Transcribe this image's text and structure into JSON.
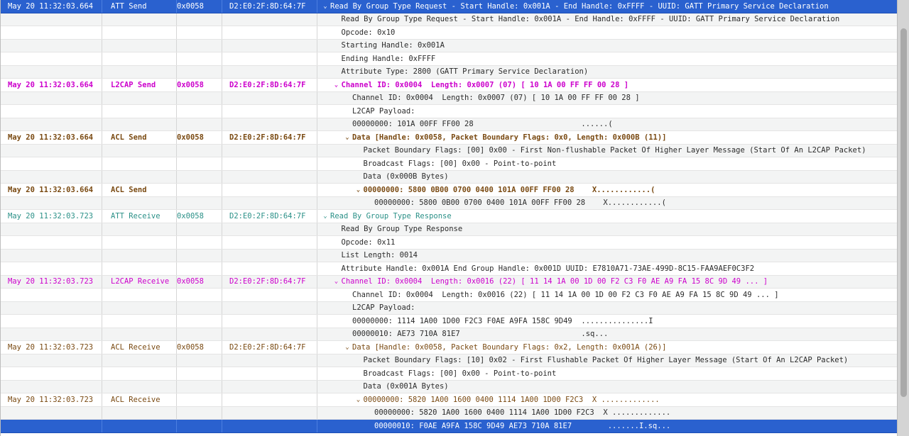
{
  "rows": [
    {
      "selected": true,
      "kind": "att",
      "bold": false,
      "time": "May 20 11:32:03.664",
      "proto": "ATT Send",
      "handle": "0x0058",
      "addr": "D2:E0:2F:8D:64:7F",
      "indent": 0,
      "disclosure": "down",
      "detail": "Read By Group Type Request - Start Handle: 0x001A - End Handle: 0xFFFF - UUID: GATT Primary Service Declaration"
    },
    {
      "kind": "plain",
      "indent": 1,
      "detail": "Read By Group Type Request - Start Handle: 0x001A - End Handle: 0xFFFF - UUID: GATT Primary Service Declaration"
    },
    {
      "kind": "plain",
      "indent": 1,
      "detail": "Opcode: 0x10"
    },
    {
      "kind": "plain",
      "indent": 1,
      "detail": "Starting Handle: 0x001A"
    },
    {
      "kind": "plain",
      "indent": 1,
      "detail": "Ending Handle: 0xFFFF"
    },
    {
      "kind": "plain",
      "indent": 1,
      "detail": "Attribute Type: 2800 (GATT Primary Service Declaration)"
    },
    {
      "kind": "l2cap",
      "bold": true,
      "time": "May 20 11:32:03.664",
      "proto": "L2CAP Send",
      "handle": "0x0058",
      "addr": "D2:E0:2F:8D:64:7F",
      "indent": 1,
      "disclosure": "down",
      "detail": "Channel ID: 0x0004  Length: 0x0007 (07) [ 10 1A 00 FF FF 00 28 ]"
    },
    {
      "kind": "plain",
      "indent": 2,
      "detail": "Channel ID: 0x0004  Length: 0x0007 (07) [ 10 1A 00 FF FF 00 28 ]"
    },
    {
      "kind": "plain",
      "indent": 2,
      "detail": "L2CAP Payload:"
    },
    {
      "kind": "plain",
      "indent": 2,
      "detail": "00000000: 101A 00FF FF00 28                        ......("
    },
    {
      "kind": "acl",
      "bold": true,
      "time": "May 20 11:32:03.664",
      "proto": "ACL Send",
      "handle": "0x0058",
      "addr": "D2:E0:2F:8D:64:7F",
      "indent": 2,
      "disclosure": "down",
      "detail": "Data [Handle: 0x0058, Packet Boundary Flags: 0x0, Length: 0x000B (11)]"
    },
    {
      "kind": "plain",
      "indent": 3,
      "detail": "Packet Boundary Flags: [00] 0x00 - First Non-flushable Packet Of Higher Layer Message (Start Of An L2CAP Packet)"
    },
    {
      "kind": "plain",
      "indent": 3,
      "detail": "Broadcast Flags: [00] 0x00 - Point-to-point"
    },
    {
      "kind": "plain",
      "indent": 3,
      "detail": "Data (0x000B Bytes)"
    },
    {
      "kind": "acl",
      "bold": true,
      "time": "May 20 11:32:03.664",
      "proto": "ACL Send",
      "indent": 3,
      "disclosure": "down",
      "detail": "00000000: 5800 0B00 0700 0400 101A 00FF FF00 28    X............("
    },
    {
      "kind": "plain",
      "indent": 4,
      "detail": "00000000: 5800 0B00 0700 0400 101A 00FF FF00 28    X............("
    },
    {
      "kind": "att",
      "bold": false,
      "time": "May 20 11:32:03.723",
      "proto": "ATT Receive",
      "handle": "0x0058",
      "addr": "D2:E0:2F:8D:64:7F",
      "indent": 0,
      "disclosure": "down",
      "detail": "Read By Group Type Response"
    },
    {
      "kind": "plain",
      "indent": 1,
      "detail": "Read By Group Type Response"
    },
    {
      "kind": "plain",
      "indent": 1,
      "detail": "Opcode: 0x11"
    },
    {
      "kind": "plain",
      "indent": 1,
      "detail": "List Length: 0014"
    },
    {
      "kind": "plain",
      "indent": 1,
      "detail": "Attribute Handle: 0x001A End Group Handle: 0x001D UUID: E7810A71-73AE-499D-8C15-FAA9AEF0C3F2"
    },
    {
      "kind": "l2cap",
      "bold": false,
      "time": "May 20 11:32:03.723",
      "proto": "L2CAP Receive",
      "handle": "0x0058",
      "addr": "D2:E0:2F:8D:64:7F",
      "indent": 1,
      "disclosure": "down",
      "detail": "Channel ID: 0x0004  Length: 0x0016 (22) [ 11 14 1A 00 1D 00 F2 C3 F0 AE A9 FA 15 8C 9D 49 ... ]"
    },
    {
      "kind": "plain",
      "indent": 2,
      "detail": "Channel ID: 0x0004  Length: 0x0016 (22) [ 11 14 1A 00 1D 00 F2 C3 F0 AE A9 FA 15 8C 9D 49 ... ]"
    },
    {
      "kind": "plain",
      "indent": 2,
      "detail": "L2CAP Payload:"
    },
    {
      "kind": "plain",
      "indent": 2,
      "detail": "00000000: 1114 1A00 1D00 F2C3 F0AE A9FA 158C 9D49  ...............I"
    },
    {
      "kind": "plain",
      "indent": 2,
      "detail": "00000010: AE73 710A 81E7                           .sq..."
    },
    {
      "kind": "acl",
      "bold": false,
      "time": "May 20 11:32:03.723",
      "proto": "ACL Receive",
      "handle": "0x0058",
      "addr": "D2:E0:2F:8D:64:7F",
      "indent": 2,
      "disclosure": "down",
      "detail": "Data [Handle: 0x0058, Packet Boundary Flags: 0x2, Length: 0x001A (26)]"
    },
    {
      "kind": "plain",
      "indent": 3,
      "detail": "Packet Boundary Flags: [10] 0x02 - First Flushable Packet Of Higher Layer Message (Start Of An L2CAP Packet)"
    },
    {
      "kind": "plain",
      "indent": 3,
      "detail": "Broadcast Flags: [00] 0x00 - Point-to-point"
    },
    {
      "kind": "plain",
      "indent": 3,
      "detail": "Data (0x001A Bytes)"
    },
    {
      "kind": "acl",
      "bold": false,
      "time": "May 20 11:32:03.723",
      "proto": "ACL Receive",
      "indent": 3,
      "disclosure": "down",
      "detail": "00000000: 5820 1A00 1600 0400 1114 1A00 1D00 F2C3  X ............."
    },
    {
      "kind": "plain",
      "indent": 4,
      "detail": "00000000: 5820 1A00 1600 0400 1114 1A00 1D00 F2C3  X ............."
    },
    {
      "selected": true,
      "kind": "plain",
      "indent": 4,
      "detail": "00000010: F0AE A9FA 158C 9D49 AE73 710A 81E7        .......I.sq..."
    }
  ]
}
